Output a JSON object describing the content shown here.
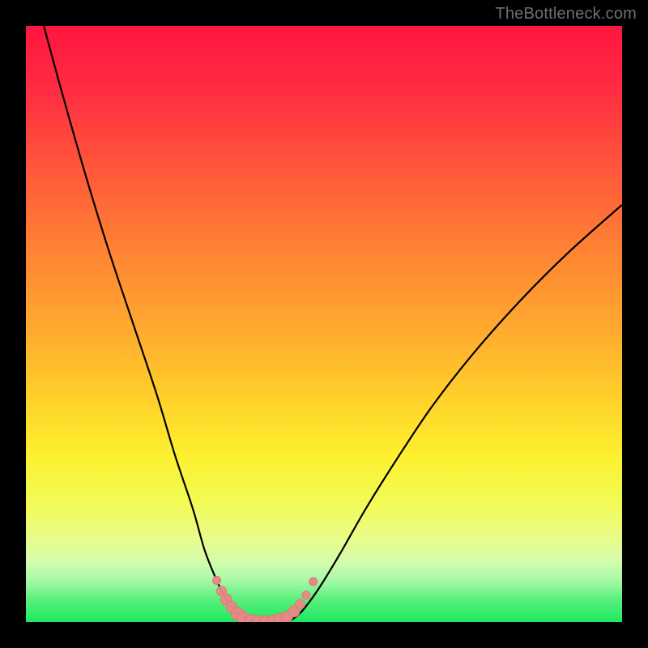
{
  "watermark": "TheBottleneck.com",
  "chart_data": {
    "type": "line",
    "title": "",
    "xlabel": "",
    "ylabel": "",
    "xlim": [
      0,
      100
    ],
    "ylim": [
      0,
      100
    ],
    "background_gradient_stops": [
      {
        "pos": 0,
        "color": "#ff163f"
      },
      {
        "pos": 50,
        "color": "#ffad2e"
      },
      {
        "pos": 80,
        "color": "#f2fb56"
      },
      {
        "pos": 100,
        "color": "#1be860"
      }
    ],
    "series": [
      {
        "name": "left-curve",
        "x": [
          3,
          6,
          10,
          14,
          18,
          22,
          25,
          28,
          30,
          32,
          33.5,
          35,
          36.5,
          38
        ],
        "y": [
          100,
          89,
          75,
          62,
          50,
          38,
          28,
          19,
          12,
          7,
          4,
          2,
          0.8,
          0
        ]
      },
      {
        "name": "right-curve",
        "x": [
          44,
          46,
          48,
          50,
          53,
          57,
          62,
          68,
          75,
          83,
          91,
          100
        ],
        "y": [
          0,
          1.5,
          4,
          7,
          12,
          19,
          27,
          36,
          45,
          54,
          62,
          70
        ]
      }
    ],
    "markers": [
      {
        "x": 32.0,
        "y": 7.0,
        "r": 5
      },
      {
        "x": 32.8,
        "y": 5.2,
        "r": 6
      },
      {
        "x": 33.6,
        "y": 3.8,
        "r": 7
      },
      {
        "x": 34.5,
        "y": 2.5,
        "r": 7
      },
      {
        "x": 35.5,
        "y": 1.4,
        "r": 8
      },
      {
        "x": 36.5,
        "y": 0.6,
        "r": 8
      },
      {
        "x": 37.8,
        "y": 0.2,
        "r": 8
      },
      {
        "x": 39.0,
        "y": 0.0,
        "r": 8
      },
      {
        "x": 40.3,
        "y": 0.0,
        "r": 8
      },
      {
        "x": 41.5,
        "y": 0.1,
        "r": 8
      },
      {
        "x": 42.7,
        "y": 0.4,
        "r": 8
      },
      {
        "x": 43.8,
        "y": 0.9,
        "r": 7
      },
      {
        "x": 45.0,
        "y": 1.8,
        "r": 7
      },
      {
        "x": 46.0,
        "y": 3.0,
        "r": 6
      },
      {
        "x": 47.0,
        "y": 4.5,
        "r": 5
      },
      {
        "x": 48.2,
        "y": 6.8,
        "r": 5
      }
    ]
  }
}
